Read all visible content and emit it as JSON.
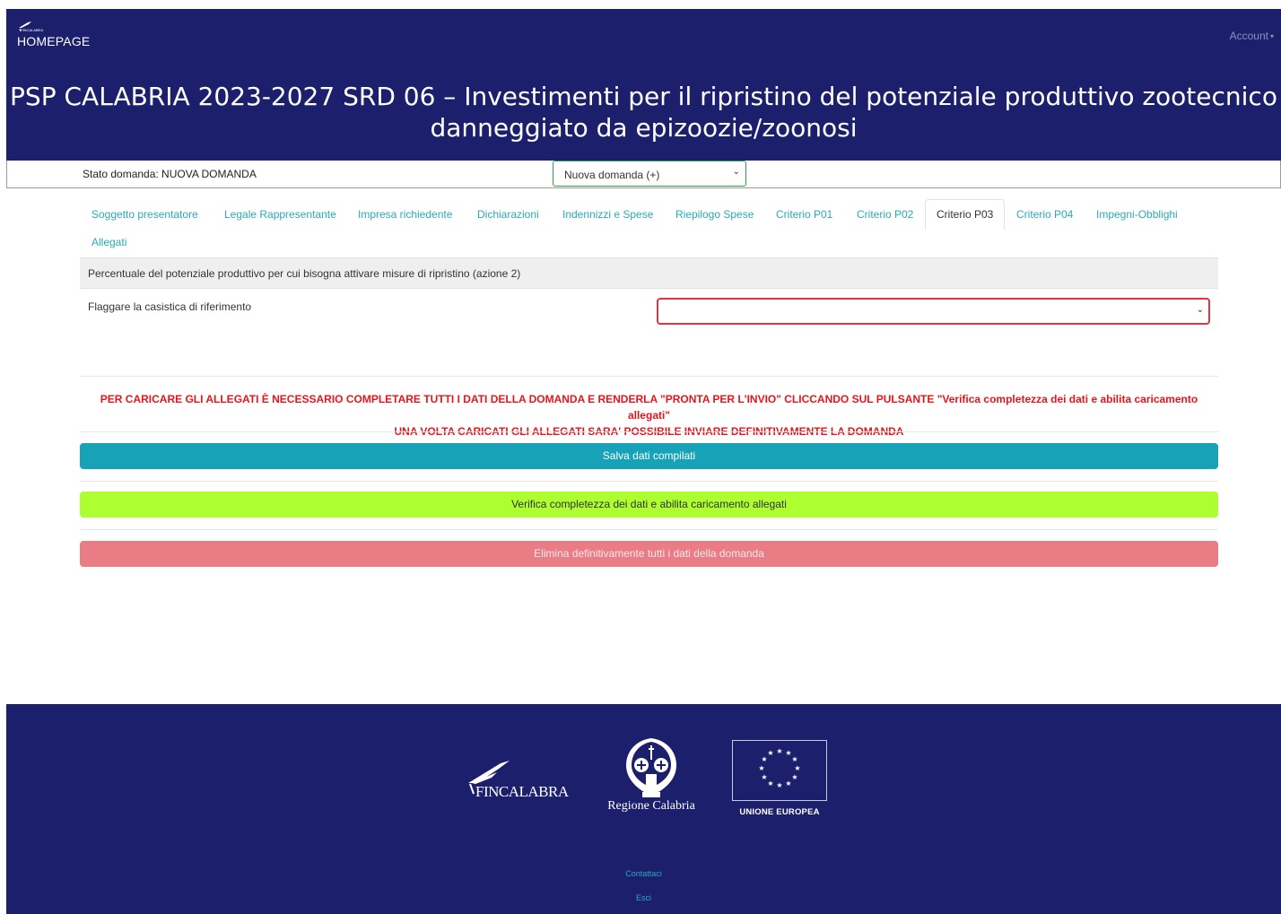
{
  "header": {
    "brand_small": "FINCALABRA",
    "home_label": "HOMEPAGE",
    "account_label": "Account",
    "title_line1": "PSP CALABRIA 2023-2027 SRD 06 – Investimenti per il ripristino del potenziale produttivo zootecnico",
    "title_line2": "danneggiato da epizoozie/zoonosi",
    "bg_color": "#1c1f6b"
  },
  "status": {
    "stato_label": "Stato domanda: NUOVA DOMANDA",
    "select_value": "Nuova domanda (+)"
  },
  "tabs": [
    {
      "label": "Soggetto presentatore"
    },
    {
      "label": "Legale Rappresentante"
    },
    {
      "label": "Impresa richiedente"
    },
    {
      "label": "Dichiarazioni"
    },
    {
      "label": "Indennizzi e Spese"
    },
    {
      "label": "Riepilogo Spese"
    },
    {
      "label": "Criterio P01"
    },
    {
      "label": "Criterio P02"
    },
    {
      "label": "Criterio P03",
      "active": true
    },
    {
      "label": "Criterio P04"
    },
    {
      "label": "Impegni-Obblighi"
    },
    {
      "label": "Allegati"
    }
  ],
  "form": {
    "section_title": "Percentuale del potenziale produttivo per cui bisogna attivare misure di ripristino (azione 2)",
    "flag_label": "Flaggare la casistica di riferimento",
    "flag_value": ""
  },
  "warning": {
    "line1": "PER CARICARE GLI ALLEGATI È NECESSARIO COMPLETARE TUTTI I DATI DELLA DOMANDA E RENDERLA \"PRONTA PER L'INVIO\" CLICCANDO SUL PULSANTE \"Verifica completezza dei dati e abilita caricamento allegati\"",
    "line2": "UNA VOLTA CARICATI GLI ALLEGATI SARA' POSSIBILE INVIARE DEFINITIVAMENTE LA DOMANDA"
  },
  "buttons": {
    "save": "Salva dati compilati",
    "verify": "Verifica completezza dei dati e abilita caricamento allegati",
    "delete": "Elimina definitivamente tutti i dati della domanda"
  },
  "footer": {
    "fincalabra": "FINCALABRA",
    "regione": "Regione Calabria",
    "ue": "UNIONE EUROPEA",
    "contact": "Contattaci",
    "exit": "Esci"
  }
}
